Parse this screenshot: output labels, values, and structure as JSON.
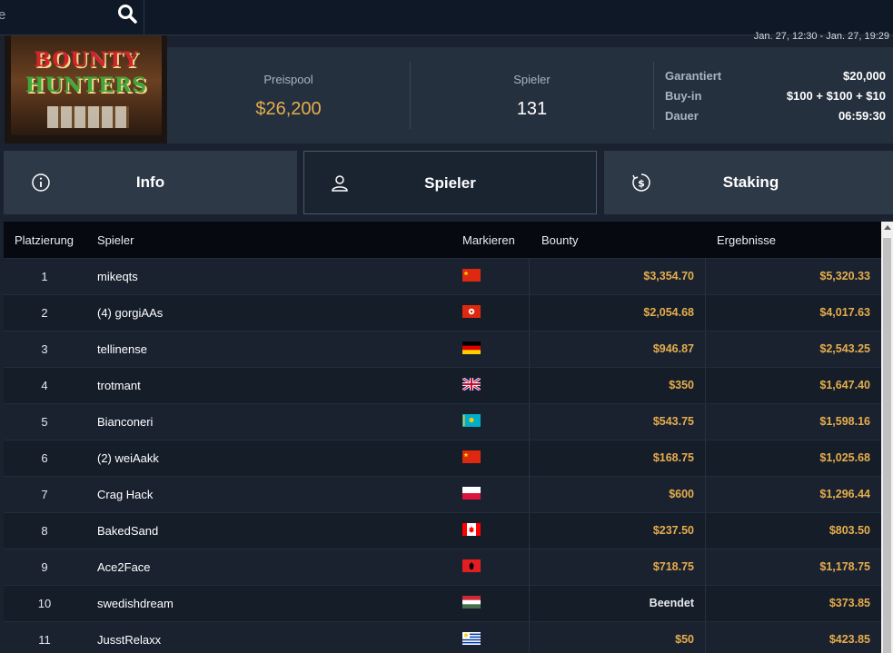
{
  "search": {
    "partial_text": "e"
  },
  "date_range": "Jan. 27, 12:30 - Jan. 27, 19:29",
  "logo": {
    "line1": "BOUNTY",
    "line2": "HUNTERS"
  },
  "stats": {
    "prizepool": {
      "label": "Preispool",
      "value": "$26,200",
      "color": "#e6ad4c"
    },
    "players": {
      "label": "Spieler",
      "value": "131",
      "color": "#ffffff"
    },
    "details": [
      {
        "label": "Garantiert",
        "value": "$20,000"
      },
      {
        "label": "Buy-in",
        "value": "$100 + $100 + $10"
      },
      {
        "label": "Dauer",
        "value": "06:59:30"
      }
    ]
  },
  "tabs": [
    {
      "label": "Info",
      "icon": "info-icon",
      "active": false
    },
    {
      "label": "Spieler",
      "icon": "user-icon",
      "active": true
    },
    {
      "label": "Staking",
      "icon": "dollar-cycle-icon",
      "active": false
    }
  ],
  "table": {
    "headers": {
      "rank": "Platzierung",
      "player": "Spieler",
      "flag": "Markieren",
      "bounty": "Bounty",
      "results": "Ergebnisse"
    },
    "rows": [
      {
        "rank": "1",
        "player": "mikeqts",
        "flag": "china",
        "bounty": "$3,354.70",
        "result": "$5,320.33"
      },
      {
        "rank": "2",
        "player": "(4) gorgiAAs",
        "flag": "hong-kong",
        "bounty": "$2,054.68",
        "result": "$4,017.63"
      },
      {
        "rank": "3",
        "player": "tellinense",
        "flag": "germany",
        "bounty": "$946.87",
        "result": "$2,543.25"
      },
      {
        "rank": "4",
        "player": "trotmant",
        "flag": "united-kingdom",
        "bounty": "$350",
        "result": "$1,647.40"
      },
      {
        "rank": "5",
        "player": "Bianconeri",
        "flag": "kazakhstan",
        "bounty": "$543.75",
        "result": "$1,598.16"
      },
      {
        "rank": "6",
        "player": "(2) weiAakk",
        "flag": "china",
        "bounty": "$168.75",
        "result": "$1,025.68"
      },
      {
        "rank": "7",
        "player": "Crag Hack",
        "flag": "poland",
        "bounty": "$600",
        "result": "$1,296.44"
      },
      {
        "rank": "8",
        "player": "BakedSand",
        "flag": "canada",
        "bounty": "$237.50",
        "result": "$803.50"
      },
      {
        "rank": "9",
        "player": "Ace2Face",
        "flag": "albania",
        "bounty": "$718.75",
        "result": "$1,178.75"
      },
      {
        "rank": "10",
        "player": "swedishdream",
        "flag": "hungary",
        "bounty": "Beendet",
        "result": "$373.85"
      },
      {
        "rank": "11",
        "player": "JusstRelaxx",
        "flag": "uruguay",
        "bounty": "$50",
        "result": "$423.85"
      }
    ]
  },
  "colors": {
    "accent_gold": "#e6ad4c",
    "background": "#1a2230",
    "header_bg": "#060a10"
  }
}
